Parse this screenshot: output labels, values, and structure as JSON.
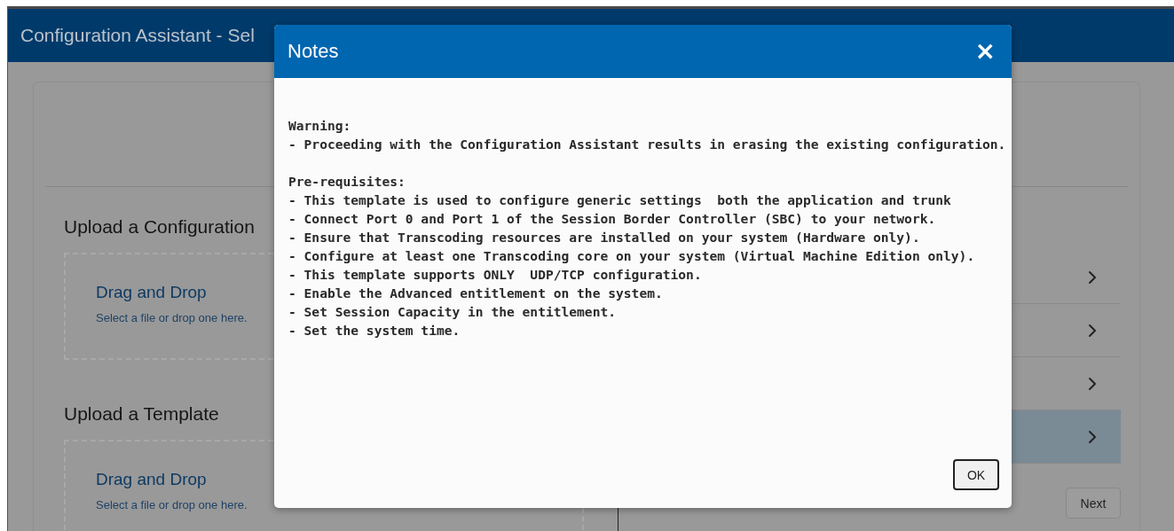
{
  "window": {
    "title": "Configuration Assistant - Sel"
  },
  "upload_sections": [
    {
      "heading": "Upload a Configuration",
      "drop_title": "Drag and Drop",
      "drop_hint": "Select a file or drop one here."
    },
    {
      "heading": "Upload a Template",
      "drop_title": "Drag and Drop",
      "drop_hint": "Select a file or drop one here."
    }
  ],
  "option_rows": [
    {
      "selected": false
    },
    {
      "selected": false
    },
    {
      "selected": false
    },
    {
      "selected": true
    }
  ],
  "next_button": "Next",
  "dialog": {
    "title": "Notes",
    "close": "×",
    "sections": [
      {
        "heading": "Warning:",
        "lines": [
          "- Proceeding with the Configuration Assistant results in erasing the existing configuration."
        ]
      },
      {
        "heading": "Pre-requisites:",
        "lines": [
          "- This template is used to configure generic settings  both the application and trunk",
          "- Connect Port 0 and Port 1 of the Session Border Controller (SBC) to your network.",
          "- Ensure that Transcoding resources are installed on your system (Hardware only).",
          "- Configure at least one Transcoding core on your system (Virtual Machine Edition only).",
          "- This template supports ONLY  UDP/TCP configuration.",
          "- Enable the Advanced entitlement on the system.",
          "- Set Session Capacity in the entitlement.",
          "- Set the system time."
        ]
      }
    ],
    "ok_button": "OK"
  }
}
